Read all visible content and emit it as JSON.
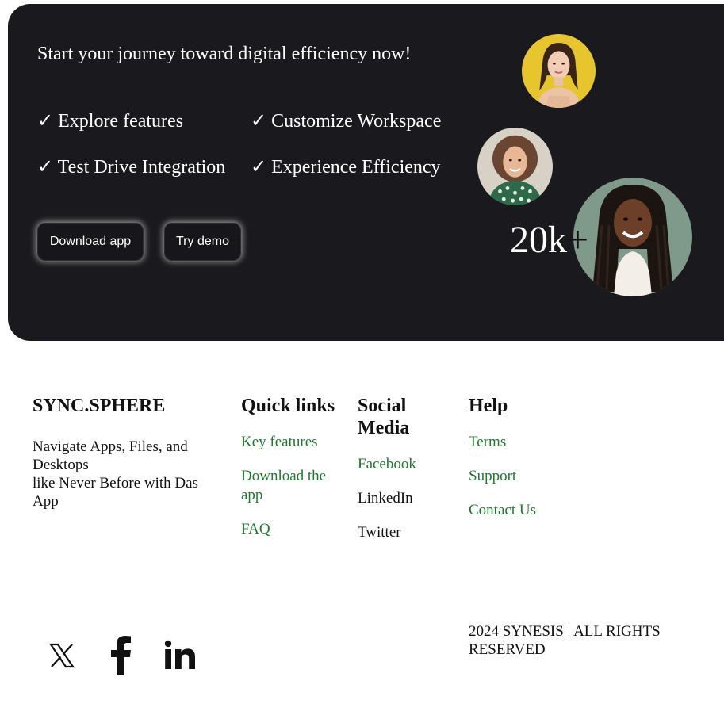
{
  "hero": {
    "headline": "Start your journey toward digital efficiency now!",
    "features": [
      "✓ Explore features",
      "✓ Customize Workspace",
      "✓ Test Drive Integration",
      "✓ Experience Efficiency"
    ],
    "download_button": "Download app",
    "demo_button": "Try demo",
    "counter_number": "20k",
    "counter_suffix": "+",
    "colors": {
      "background": "#1a191d",
      "text": "#ffffff"
    }
  },
  "footer": {
    "brand": {
      "name": "SYNC.SPHERE",
      "description_line1": "Navigate Apps, Files, and Desktops",
      "description_line2": "like Never Before with Das App"
    },
    "quick_links": {
      "title": "Quick links",
      "items": [
        "Key features",
        "Download the app",
        "FAQ"
      ]
    },
    "social_media": {
      "title": "Social Media",
      "items": [
        "Facebook",
        "LinkedIn",
        "Twitter"
      ]
    },
    "help": {
      "title": "Help",
      "items": [
        "Terms",
        "Support",
        "Contact Us"
      ]
    },
    "social_icons": [
      "x-icon",
      "facebook-icon",
      "linkedin-icon"
    ],
    "copyright": "2024 SYNESIS | ALL RIGHTS RESERVED",
    "colors": {
      "link": "#1b7a2b",
      "text": "#111111"
    }
  }
}
